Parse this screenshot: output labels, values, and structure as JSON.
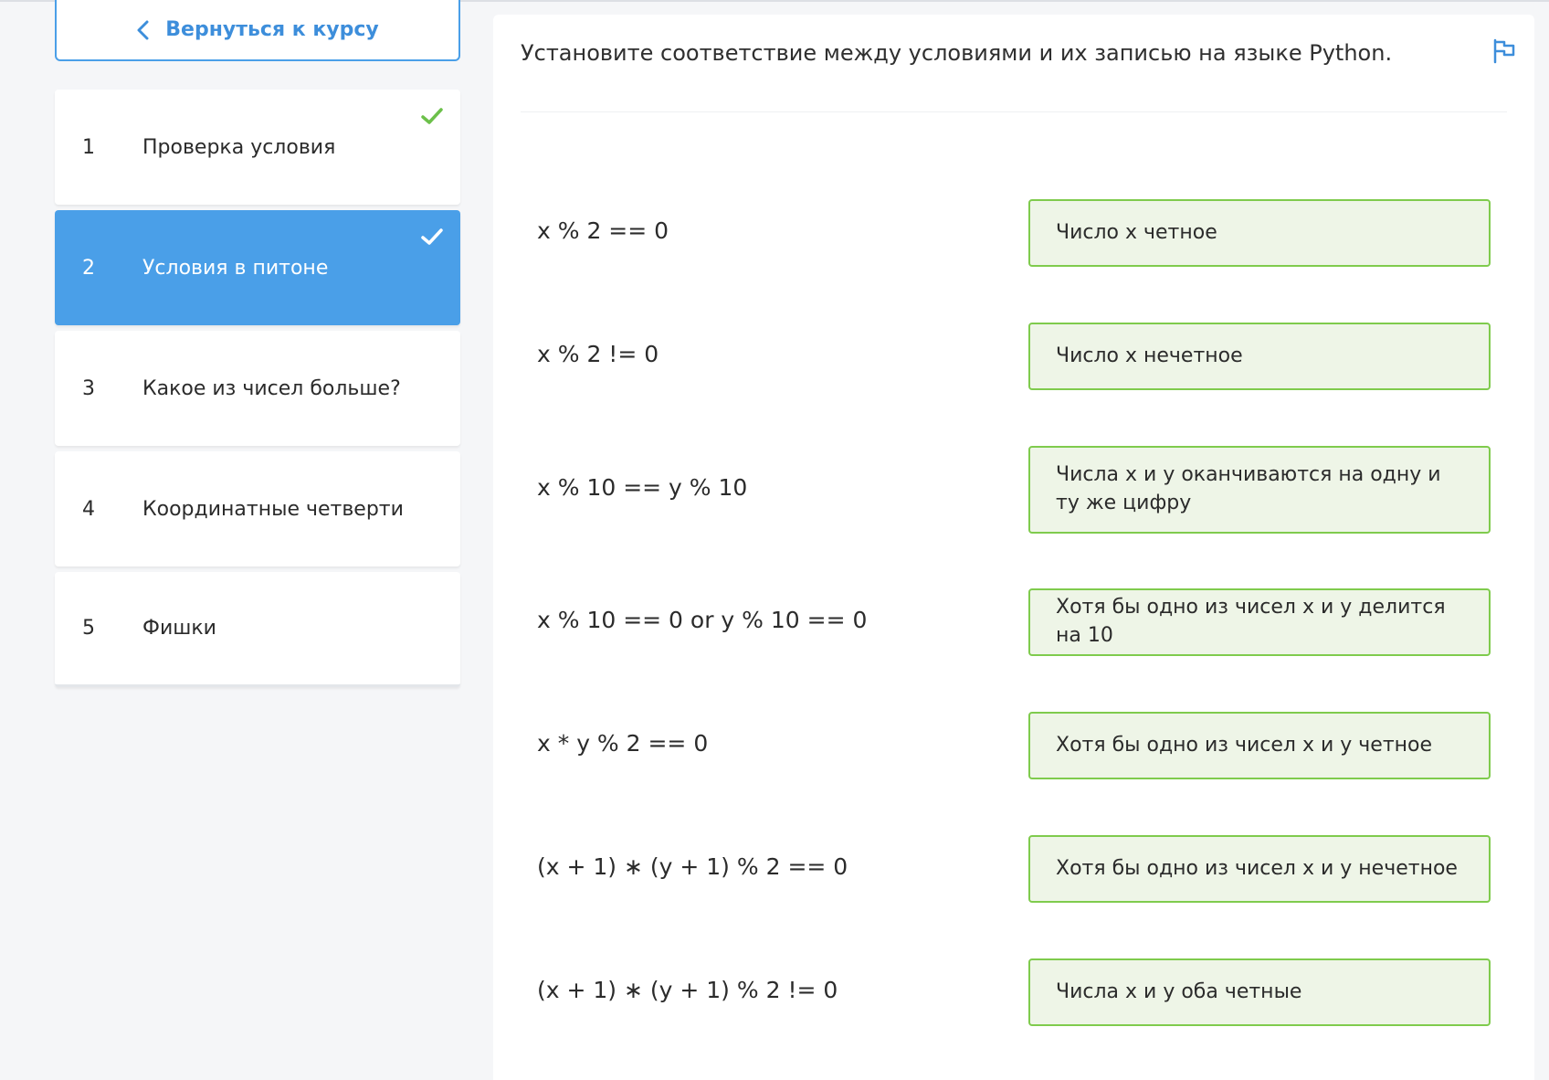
{
  "sidebar": {
    "back_label": "Вернуться к курсу",
    "lessons": [
      {
        "num": "1",
        "title": "Проверка условия"
      },
      {
        "num": "2",
        "title": "Условия в питоне"
      },
      {
        "num": "3",
        "title": "Какое из чисел больше?"
      },
      {
        "num": "4",
        "title": "Координатные четверти"
      },
      {
        "num": "5",
        "title": "Фишки"
      }
    ]
  },
  "main": {
    "question": "Установите соответствие между условиями и их записью на языке Python.",
    "pairs": [
      {
        "expr": "x % 2 == 0",
        "option": "Число x четное"
      },
      {
        "expr": "x % 2 != 0",
        "option": "Число x нечетное"
      },
      {
        "expr": "x % 10 == y % 10",
        "option": "Числа x и y оканчиваются на одну и ту же цифру"
      },
      {
        "expr": "x % 10 == 0 or y % 10 == 0",
        "option": "Хотя бы одно из чисел x и y делится на 10"
      },
      {
        "expr": "x * y % 2 == 0",
        "option": "Хотя бы одно из чисел x и y четное"
      },
      {
        "expr": "(x + 1) ∗ (y + 1) % 2 == 0",
        "option": "Хотя бы одно из чисел x и y нечетное"
      },
      {
        "expr": "(x + 1) ∗ (y + 1) % 2 != 0",
        "option": "Числа x и y оба четные"
      }
    ]
  },
  "colors": {
    "accent": "#4a9fe8",
    "check_green": "#6cc04a",
    "option_border": "#7fcb4d",
    "option_bg": "#eef5e7"
  },
  "icons": {
    "back": "chevron-left-icon",
    "done": "checkmark-icon",
    "report": "flag-icon"
  }
}
